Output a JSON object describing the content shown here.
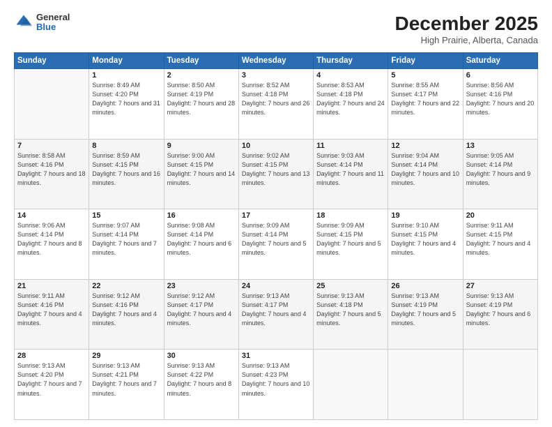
{
  "header": {
    "logo_general": "General",
    "logo_blue": "Blue",
    "month": "December 2025",
    "location": "High Prairie, Alberta, Canada"
  },
  "weekdays": [
    "Sunday",
    "Monday",
    "Tuesday",
    "Wednesday",
    "Thursday",
    "Friday",
    "Saturday"
  ],
  "weeks": [
    [
      {
        "day": "",
        "sunrise": "",
        "sunset": "",
        "daylight": ""
      },
      {
        "day": "1",
        "sunrise": "Sunrise: 8:49 AM",
        "sunset": "Sunset: 4:20 PM",
        "daylight": "Daylight: 7 hours and 31 minutes."
      },
      {
        "day": "2",
        "sunrise": "Sunrise: 8:50 AM",
        "sunset": "Sunset: 4:19 PM",
        "daylight": "Daylight: 7 hours and 28 minutes."
      },
      {
        "day": "3",
        "sunrise": "Sunrise: 8:52 AM",
        "sunset": "Sunset: 4:18 PM",
        "daylight": "Daylight: 7 hours and 26 minutes."
      },
      {
        "day": "4",
        "sunrise": "Sunrise: 8:53 AM",
        "sunset": "Sunset: 4:18 PM",
        "daylight": "Daylight: 7 hours and 24 minutes."
      },
      {
        "day": "5",
        "sunrise": "Sunrise: 8:55 AM",
        "sunset": "Sunset: 4:17 PM",
        "daylight": "Daylight: 7 hours and 22 minutes."
      },
      {
        "day": "6",
        "sunrise": "Sunrise: 8:56 AM",
        "sunset": "Sunset: 4:16 PM",
        "daylight": "Daylight: 7 hours and 20 minutes."
      }
    ],
    [
      {
        "day": "7",
        "sunrise": "Sunrise: 8:58 AM",
        "sunset": "Sunset: 4:16 PM",
        "daylight": "Daylight: 7 hours and 18 minutes."
      },
      {
        "day": "8",
        "sunrise": "Sunrise: 8:59 AM",
        "sunset": "Sunset: 4:15 PM",
        "daylight": "Daylight: 7 hours and 16 minutes."
      },
      {
        "day": "9",
        "sunrise": "Sunrise: 9:00 AM",
        "sunset": "Sunset: 4:15 PM",
        "daylight": "Daylight: 7 hours and 14 minutes."
      },
      {
        "day": "10",
        "sunrise": "Sunrise: 9:02 AM",
        "sunset": "Sunset: 4:15 PM",
        "daylight": "Daylight: 7 hours and 13 minutes."
      },
      {
        "day": "11",
        "sunrise": "Sunrise: 9:03 AM",
        "sunset": "Sunset: 4:14 PM",
        "daylight": "Daylight: 7 hours and 11 minutes."
      },
      {
        "day": "12",
        "sunrise": "Sunrise: 9:04 AM",
        "sunset": "Sunset: 4:14 PM",
        "daylight": "Daylight: 7 hours and 10 minutes."
      },
      {
        "day": "13",
        "sunrise": "Sunrise: 9:05 AM",
        "sunset": "Sunset: 4:14 PM",
        "daylight": "Daylight: 7 hours and 9 minutes."
      }
    ],
    [
      {
        "day": "14",
        "sunrise": "Sunrise: 9:06 AM",
        "sunset": "Sunset: 4:14 PM",
        "daylight": "Daylight: 7 hours and 8 minutes."
      },
      {
        "day": "15",
        "sunrise": "Sunrise: 9:07 AM",
        "sunset": "Sunset: 4:14 PM",
        "daylight": "Daylight: 7 hours and 7 minutes."
      },
      {
        "day": "16",
        "sunrise": "Sunrise: 9:08 AM",
        "sunset": "Sunset: 4:14 PM",
        "daylight": "Daylight: 7 hours and 6 minutes."
      },
      {
        "day": "17",
        "sunrise": "Sunrise: 9:09 AM",
        "sunset": "Sunset: 4:14 PM",
        "daylight": "Daylight: 7 hours and 5 minutes."
      },
      {
        "day": "18",
        "sunrise": "Sunrise: 9:09 AM",
        "sunset": "Sunset: 4:15 PM",
        "daylight": "Daylight: 7 hours and 5 minutes."
      },
      {
        "day": "19",
        "sunrise": "Sunrise: 9:10 AM",
        "sunset": "Sunset: 4:15 PM",
        "daylight": "Daylight: 7 hours and 4 minutes."
      },
      {
        "day": "20",
        "sunrise": "Sunrise: 9:11 AM",
        "sunset": "Sunset: 4:15 PM",
        "daylight": "Daylight: 7 hours and 4 minutes."
      }
    ],
    [
      {
        "day": "21",
        "sunrise": "Sunrise: 9:11 AM",
        "sunset": "Sunset: 4:16 PM",
        "daylight": "Daylight: 7 hours and 4 minutes."
      },
      {
        "day": "22",
        "sunrise": "Sunrise: 9:12 AM",
        "sunset": "Sunset: 4:16 PM",
        "daylight": "Daylight: 7 hours and 4 minutes."
      },
      {
        "day": "23",
        "sunrise": "Sunrise: 9:12 AM",
        "sunset": "Sunset: 4:17 PM",
        "daylight": "Daylight: 7 hours and 4 minutes."
      },
      {
        "day": "24",
        "sunrise": "Sunrise: 9:13 AM",
        "sunset": "Sunset: 4:17 PM",
        "daylight": "Daylight: 7 hours and 4 minutes."
      },
      {
        "day": "25",
        "sunrise": "Sunrise: 9:13 AM",
        "sunset": "Sunset: 4:18 PM",
        "daylight": "Daylight: 7 hours and 5 minutes."
      },
      {
        "day": "26",
        "sunrise": "Sunrise: 9:13 AM",
        "sunset": "Sunset: 4:19 PM",
        "daylight": "Daylight: 7 hours and 5 minutes."
      },
      {
        "day": "27",
        "sunrise": "Sunrise: 9:13 AM",
        "sunset": "Sunset: 4:19 PM",
        "daylight": "Daylight: 7 hours and 6 minutes."
      }
    ],
    [
      {
        "day": "28",
        "sunrise": "Sunrise: 9:13 AM",
        "sunset": "Sunset: 4:20 PM",
        "daylight": "Daylight: 7 hours and 7 minutes."
      },
      {
        "day": "29",
        "sunrise": "Sunrise: 9:13 AM",
        "sunset": "Sunset: 4:21 PM",
        "daylight": "Daylight: 7 hours and 7 minutes."
      },
      {
        "day": "30",
        "sunrise": "Sunrise: 9:13 AM",
        "sunset": "Sunset: 4:22 PM",
        "daylight": "Daylight: 7 hours and 8 minutes."
      },
      {
        "day": "31",
        "sunrise": "Sunrise: 9:13 AM",
        "sunset": "Sunset: 4:23 PM",
        "daylight": "Daylight: 7 hours and 10 minutes."
      },
      {
        "day": "",
        "sunrise": "",
        "sunset": "",
        "daylight": ""
      },
      {
        "day": "",
        "sunrise": "",
        "sunset": "",
        "daylight": ""
      },
      {
        "day": "",
        "sunrise": "",
        "sunset": "",
        "daylight": ""
      }
    ]
  ]
}
